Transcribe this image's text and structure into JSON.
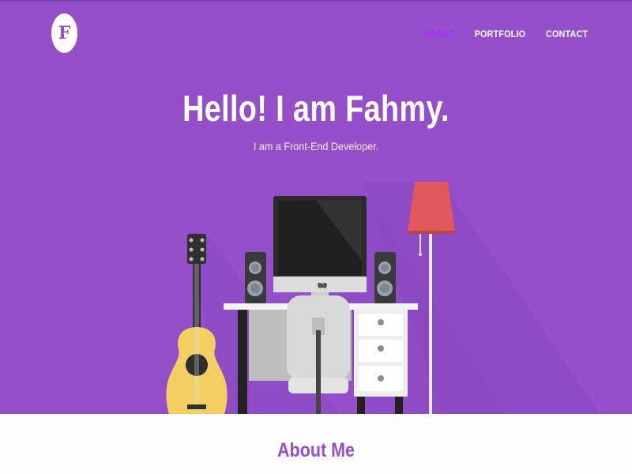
{
  "logo": {
    "letter": "F"
  },
  "nav": {
    "items": [
      {
        "label": "ABOUT",
        "active": true
      },
      {
        "label": "PORTFOLIO",
        "active": false
      },
      {
        "label": "CONTACT",
        "active": false
      }
    ]
  },
  "hero": {
    "title": "Hello! I am Fahmy.",
    "subtitle": "I am a Front-End Developer."
  },
  "about": {
    "title": "About Me"
  },
  "colors": {
    "hero_bg": "#9550c9",
    "nav_active": "#a72cff",
    "accent_text": "#9550c9",
    "lamp_shade": "#e0585b",
    "guitar_body": "#f6cf63",
    "monitor": "#2b2b2b"
  }
}
